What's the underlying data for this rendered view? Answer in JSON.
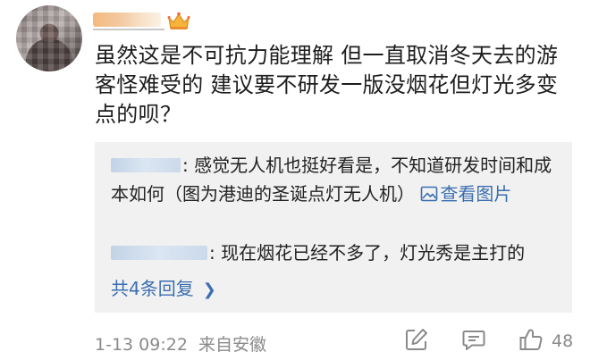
{
  "post": {
    "text": "虽然这是不可抗力能理解 但一直取消冬天去的游客怪难受的 建议要不研发一版没烟花但灯光多变点的呗？"
  },
  "replies": [
    {
      "text": ": 感觉无人机也挺好看是，不知道研发时间和成本如何（图为港迪的圣诞点灯无人机）",
      "link_label": "查看图片"
    },
    {
      "text": ": 现在烟花已经不多了，灯光秀是主打的"
    }
  ],
  "more_replies_label": "共4条回复",
  "meta": {
    "time": "1-13 09:22",
    "source": "来自安徽"
  },
  "actions": {
    "like_count": "48"
  },
  "icons": {
    "crown": "crown-icon",
    "view_image": "image-icon",
    "chevron": "chevron-right-icon",
    "edit": "edit-icon",
    "comment": "comment-icon",
    "like": "thumbs-up-icon"
  },
  "colors": {
    "link": "#3b6fb0",
    "reply_background": "#f1f1f1",
    "meta_text": "#8a8a8a"
  }
}
